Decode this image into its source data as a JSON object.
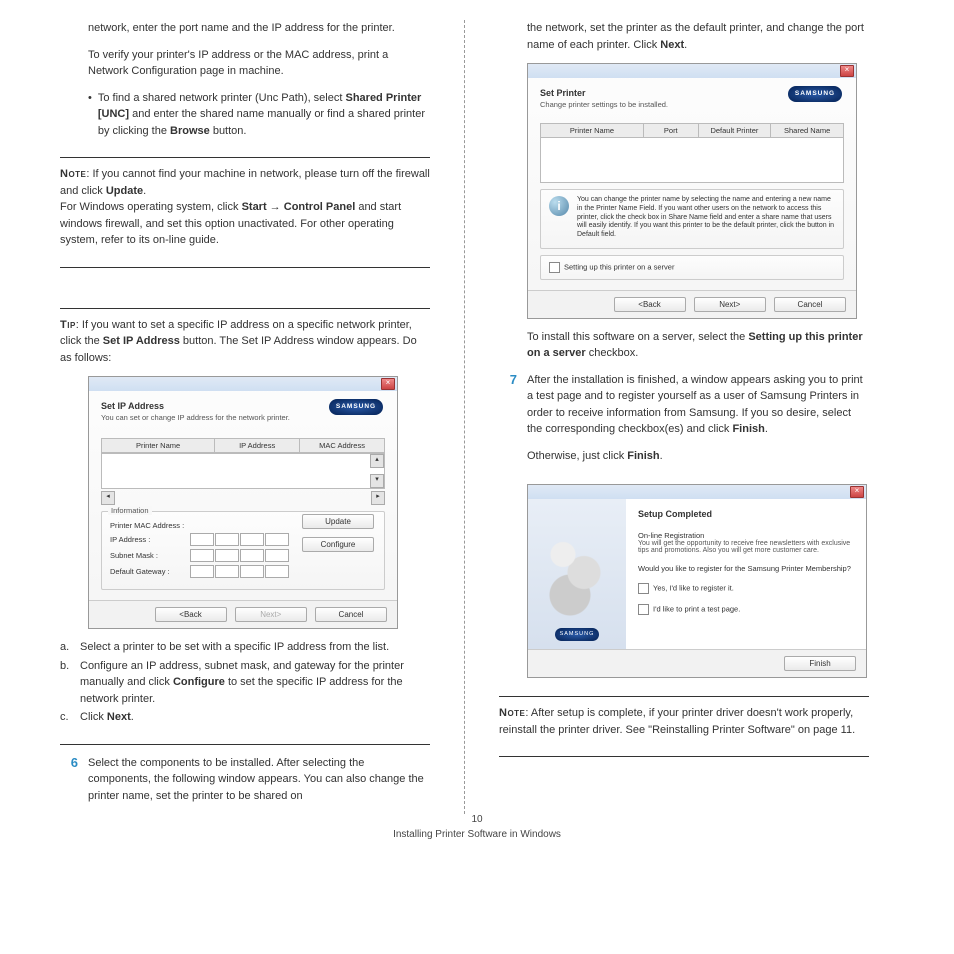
{
  "page_number": "10",
  "footer_text": "Installing Printer Software in Windows",
  "left": {
    "para1": "network, enter the port name and the IP address for the printer.",
    "para2": "To verify your printer's IP address or the MAC address, print a Network Configuration page in machine.",
    "bullet_a": "To find a shared network printer (Unc Path), select ",
    "bullet_b": "Shared Printer [UNC]",
    "bullet_c": " and enter the shared name manually or find a shared printer by clicking the ",
    "bullet_d": "Browse",
    "bullet_e": " button.",
    "note_label": "Note",
    "note_a": ": If you cannot find your machine in network, please turn off the firewall and click ",
    "note_b": "Update",
    "note_c": ".",
    "note_d": "For Windows operating system, click ",
    "note_e": "Start",
    "note_arrow": " → ",
    "note_f": "Control Panel",
    "note_g": " and  start windows firewall, and set this option unactivated. For other operating system, refer to its on-line guide.",
    "tip_label": "Tip",
    "tip_a": ": If you want to set a specific IP address on a specific network printer, click the ",
    "tip_b": "Set IP Address",
    "tip_c": " button. The Set IP Address window appears. Do as follows:",
    "sub_a": "Select a printer to be set with a specific IP address from the list.",
    "sub_b_1": "Configure an IP address, subnet mask, and gateway for the printer manually and click ",
    "sub_b_2": "Configure",
    "sub_b_3": " to set the specific IP address for the network printer.",
    "sub_c_1": "Click ",
    "sub_c_2": "Next",
    "sub_c_3": ".",
    "step6_num": "6",
    "step6": "Select the components to be installed. After selecting the components, the following window appears. You can also change the printer name, set the printer to be shared on"
  },
  "right": {
    "para1_a": "the network, set the printer as the default printer, and change the port name of each printer. Click ",
    "para1_b": "Next",
    "para1_c": ".",
    "serverline_a": "To install this software on a server, select the ",
    "serverline_b": "Setting up this printer on a server",
    "serverline_c": " checkbox.",
    "step7_num": "7",
    "step7_a": "After the installation is finished, a window appears asking you to print a test page and to register yourself as a user of Samsung Printers in order to receive information from Samsung. If you so desire, select the corresponding checkbox(es) and click ",
    "step7_b": "Finish",
    "step7_c": ".",
    "otherwise_a": "Otherwise, just click ",
    "otherwise_b": "Finish",
    "otherwise_c": ".",
    "note2_label": "Note",
    "note2": ": After setup is complete, if your printer driver doesn't work properly, reinstall the printer driver. See \"Reinstalling Printer Software\" on page 11."
  },
  "shot_ip": {
    "title": "Set IP Address",
    "sub": "You can set or change IP address for the network printer.",
    "brand": "SAMSUNG",
    "col1": "Printer Name",
    "col2": "IP Address",
    "col3": "MAC Address",
    "grp_label": "Information",
    "f1": "Printer MAC Address :",
    "f2": "IP Address :",
    "f3": "Subnet Mask :",
    "f4": "Default Gateway :",
    "btn_update": "Update",
    "btn_configure": "Configure",
    "btn_back": "<Back",
    "btn_next": "Next>",
    "btn_cancel": "Cancel"
  },
  "shot_set": {
    "title": "Set Printer",
    "sub": "Change printer settings to be installed.",
    "brand": "SAMSUNG",
    "c1": "Printer Name",
    "c2": "Port",
    "c3": "Default Printer",
    "c4": "Shared Name",
    "info_text": "You can change the printer name by selecting the name and entering a new name in the Printer Name Field. If you want other users on the network to access this printer, click the check box in Share Name field and enter a share name that users will easily identify. If you want this printer to be the default printer, click the button in Default field.",
    "chk": "Setting up this printer on a server",
    "btn_back": "<Back",
    "btn_next": "Next>",
    "btn_cancel": "Cancel"
  },
  "shot_done": {
    "title": "Setup Completed",
    "brand": "SAMSUNG",
    "l1": "On-line Registration",
    "l2": "You will get the opportunity to receive free newsletters with exclusive tips and promotions. Also you will get more customer care.",
    "l3": "Would you like to register for the Samsung Printer Membership?",
    "chk1": "Yes, I'd like to register it.",
    "chk2": "I'd like to print a test page.",
    "btn_finish": "Finish"
  }
}
